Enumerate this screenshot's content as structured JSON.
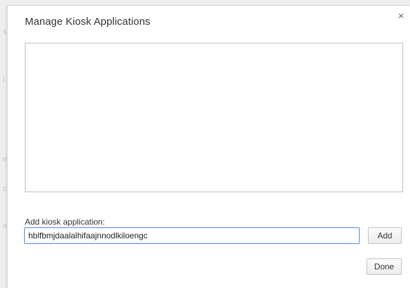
{
  "dialog": {
    "title": "Manage Kiosk Applications",
    "close_glyph": "×",
    "add_label": "Add kiosk application:",
    "app_id_value": "hblfbmjdaalalhifaajnnodlkiloengc",
    "add_button_label": "Add",
    "done_button_label": "Done",
    "apps": []
  },
  "colors": {
    "input_focus_border": "#4d90fe",
    "list_border": "#bfbfbf",
    "title_text": "#333333"
  },
  "icons": {
    "close": "close-icon"
  }
}
